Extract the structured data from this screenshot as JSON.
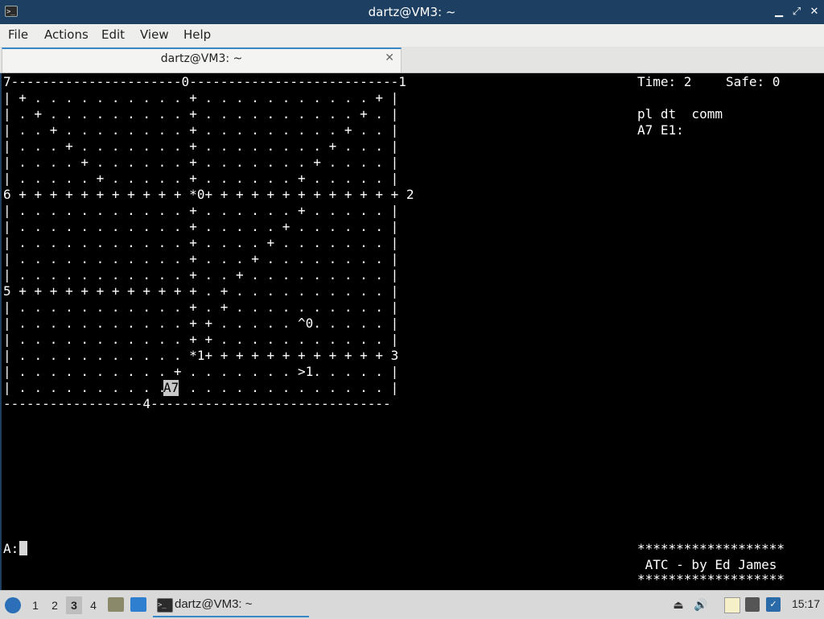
{
  "window": {
    "title": "dartz@VM3: ~",
    "app_icon": "terminal-icon",
    "controls": [
      "minimize",
      "maximize",
      "close"
    ]
  },
  "menu": [
    "File",
    "Actions",
    "Edit",
    "View",
    "Help"
  ],
  "tab": {
    "label": "dartz@VM3: ~",
    "close": "✕"
  },
  "terminal": {
    "map_rows": [
      "7----------------------0---------------------------1",
      "| + . . . . . . . . . . + . . . . . . . . . . . + |",
      "| . + . . . . . . . . . + . . . . . . . . . . + . |",
      "| . . + . . . . . . . . + . . . . . . . . . + . . |",
      "| . . . + . . . . . . . + . . . . . . . . + . . . |",
      "| . . . . + . . . . . . + . . . . . . . + . . . . |",
      "| . . . . . + . . . . . + . . . . . . + . . . . . |",
      "6 + + + + + + + + + + + *0+ + + + + + + + + + + + + 2",
      "| . . . . . . . . . . . + . . . . . . + . . . . . |",
      "| . . . . . . . . . . . + . . . . . + . . . . . . |",
      "| . . . . . . . . . . . + . . . . + . . . . . . . |",
      "| . . . . . . . . . . . + . . . + . . . . . . . . |",
      "| . . . . . . . . . . . + . . + . . . . . . . . . |",
      "5 + + + + + + + + + + + + . + . . . . . . . . . . |",
      "| . . . . . . . . . . . + . + . . . . . . . . . . |",
      "| . . . . . . . . . . . + + . . . . . ^0. . . . . |",
      "| . . . . . . . . . . . + + . . . . . . . . . . . |",
      "| . . . . . . . . . . . *1+ + + + + + + + + + + + 3",
      "| . . . . . . . . . . + . . . . . . . >1. . . . . |",
      "| . . . . . . . . . . . . . . . . . . . . . . . . |",
      "------------------4-------------------------------"
    ],
    "plane_label": "A7",
    "status": {
      "time_label": "Time: 2",
      "safe_label": "Safe: 0",
      "header": "pl dt  comm",
      "flight_line": "A7 E1:"
    },
    "prompt": "A:",
    "banner": {
      "stars_top": "*******************",
      "title": " ATC - by Ed James",
      "stars_bottom": "*******************"
    }
  },
  "taskbar": {
    "start_icon": "lxqt-start-icon",
    "workspaces": [
      "1",
      "2",
      "3",
      "4"
    ],
    "active_workspace": "3",
    "task_label": "dartz@VM3: ~",
    "tray_icons": [
      "eject-icon",
      "volume-icon",
      "clipboard-icon",
      "network-icon",
      "notification-icon"
    ],
    "clock": "15:17"
  }
}
